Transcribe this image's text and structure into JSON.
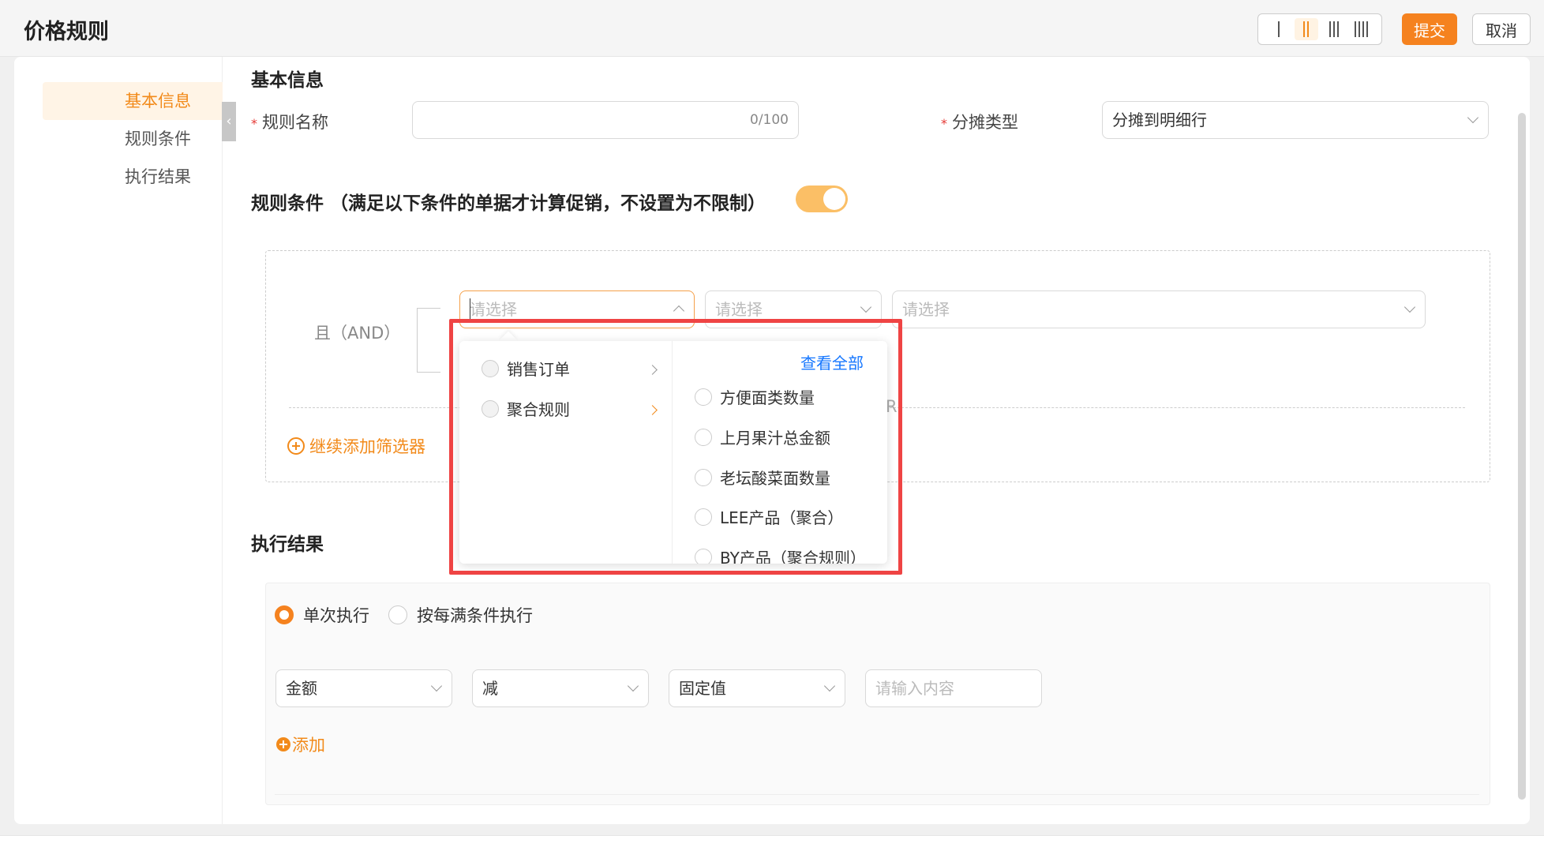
{
  "header": {
    "title": "价格规则",
    "submit_label": "提交",
    "cancel_label": "取消",
    "column_options": [
      "1",
      "2",
      "3",
      "4"
    ],
    "active_columns": "2"
  },
  "sidenav": {
    "items": [
      {
        "label": "基本信息",
        "active": true
      },
      {
        "label": "规则条件",
        "active": false
      },
      {
        "label": "执行结果",
        "active": false
      }
    ]
  },
  "basic": {
    "title": "基本信息",
    "rule_name_label": "规则名称",
    "rule_name_value": "",
    "rule_name_count": "0/100",
    "alloc_type_label": "分摊类型",
    "alloc_type_value": "分摊到明细行"
  },
  "conditions": {
    "title": "规则条件 （满足以下条件的单据才计算促销，不设置为不限制）",
    "enabled": true,
    "and_label": "且（AND）",
    "select1_placeholder": "请选择",
    "select2_placeholder": "请选择",
    "select3_placeholder": "请选择",
    "or_fragment": "R)",
    "add_filter_label": "继续添加筛选器"
  },
  "dropdown": {
    "left_items": [
      "销售订单",
      "聚合规则"
    ],
    "active_left": "聚合规则",
    "view_all": "查看全部",
    "right_items": [
      "方便面类数量",
      "上月果汁总金额",
      "老坛酸菜面数量",
      "LEE产品（聚合）",
      "BY产品（聚合规则）"
    ]
  },
  "execution": {
    "title": "执行结果",
    "mode_single": "单次执行",
    "mode_each": "按每满条件执行",
    "selected_mode": "单次执行",
    "field1": "金额",
    "field2": "减",
    "field3": "固定值",
    "value_placeholder": "请输入内容",
    "add_label": "添加"
  },
  "colors": {
    "accent": "#f5821f",
    "link": "#1677ff",
    "highlight": "#ef4444"
  }
}
